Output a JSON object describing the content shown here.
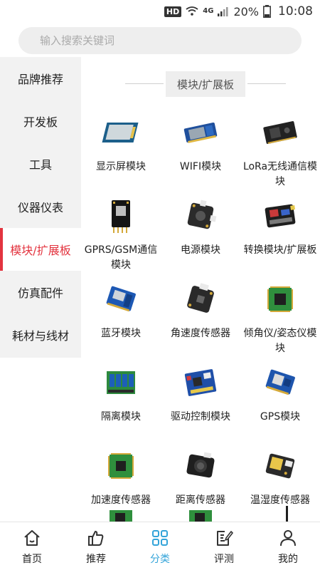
{
  "status_bar": {
    "hd": "HD",
    "network": "4G",
    "battery": "20%",
    "time": "10:08"
  },
  "search": {
    "placeholder": "输入搜索关键词"
  },
  "sidebar": {
    "items": [
      {
        "label": "品牌推荐",
        "active": false
      },
      {
        "label": "开发板",
        "active": false
      },
      {
        "label": "工具",
        "active": false
      },
      {
        "label": "仪器仪表",
        "active": false
      },
      {
        "label": "模块/扩展板",
        "active": true
      },
      {
        "label": "仿真配件",
        "active": false
      },
      {
        "label": "耗材与线材",
        "active": false
      }
    ],
    "accent_color": "#e3343f"
  },
  "section": {
    "title": "模块/扩展板"
  },
  "products": [
    {
      "label": "显示屏模块",
      "icon": "display-module-icon"
    },
    {
      "label": "WIFI模块",
      "icon": "wifi-module-icon"
    },
    {
      "label": "LoRa无线通信模块",
      "icon": "lora-module-icon"
    },
    {
      "label": "GPRS/GSM通信模块",
      "icon": "gprs-module-icon"
    },
    {
      "label": "电源模块",
      "icon": "power-module-icon"
    },
    {
      "label": "转换模块/扩展板",
      "icon": "converter-module-icon"
    },
    {
      "label": "蓝牙模块",
      "icon": "bluetooth-module-icon"
    },
    {
      "label": "角速度传感器",
      "icon": "gyro-sensor-icon"
    },
    {
      "label": "倾角仪/姿态仪模块",
      "icon": "inclinometer-module-icon"
    },
    {
      "label": "隔离模块",
      "icon": "isolation-module-icon"
    },
    {
      "label": "驱动控制模块",
      "icon": "driver-module-icon"
    },
    {
      "label": "GPS模块",
      "icon": "gps-module-icon"
    },
    {
      "label": "加速度传感器",
      "icon": "accelerometer-icon"
    },
    {
      "label": "距离传感器",
      "icon": "distance-sensor-icon"
    },
    {
      "label": "温湿度传感器",
      "icon": "humidity-sensor-icon"
    }
  ],
  "bottom_nav": {
    "items": [
      {
        "label": "首页",
        "icon": "home-icon",
        "active": false
      },
      {
        "label": "推荐",
        "icon": "thumbs-up-icon",
        "active": false
      },
      {
        "label": "分类",
        "icon": "grid-icon",
        "active": true
      },
      {
        "label": "评测",
        "icon": "review-icon",
        "active": false
      },
      {
        "label": "我的",
        "icon": "user-icon",
        "active": false
      }
    ],
    "active_color": "#34a4d9"
  }
}
